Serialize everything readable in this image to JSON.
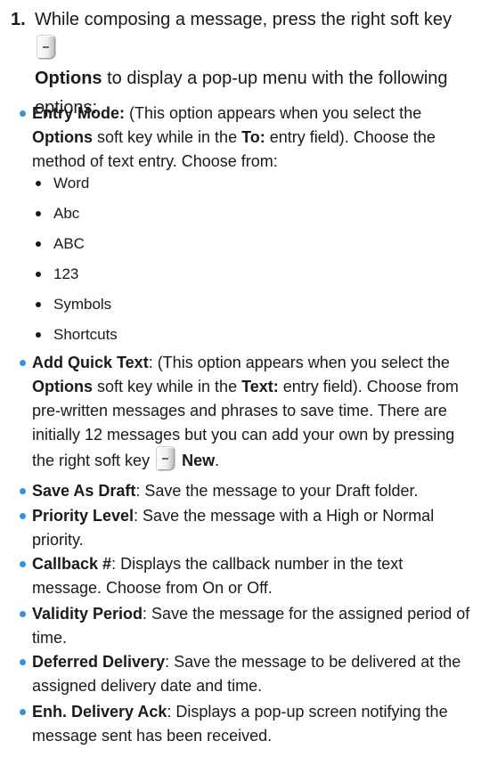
{
  "step": {
    "number": "1.",
    "text_1": "While composing a message, press the right soft key",
    "bold_1": "Options",
    "text_2": " to display a pop-up menu with the following options:"
  },
  "entry_mode": {
    "label": "Entry Mode:",
    "text_1": " (This option appears when you select the ",
    "bold_1": "Options",
    "text_2": " soft key while in the ",
    "bold_2": "To:",
    "text_3": " entry field). Choose the method of text entry. Choose from:",
    "options": [
      "Word",
      "Abc",
      "ABC",
      "123",
      "Symbols",
      "Shortcuts"
    ]
  },
  "add_quick_text": {
    "label": "Add Quick Text",
    "text_1": ": (This option appears when you select the ",
    "bold_1": "Options",
    "text_2": " soft key while in the ",
    "bold_2": "Text:",
    "text_3": " entry field). Choose from pre-written messages and phrases to save time. There are initially 12 messages but you can add your own by pressing the right soft key",
    "bold_3": "New",
    "text_4": "."
  },
  "items": [
    {
      "label": "Save As Draft",
      "text": ": Save the message to your Draft folder."
    },
    {
      "label": "Priority Level",
      "text": ": Save the message with a High or Normal priority."
    },
    {
      "label": "Callback #",
      "text": ": Displays the callback number in the text message. Choose from On or Off."
    },
    {
      "label": "Validity Period",
      "text": ": Save the message for the assigned period of time."
    },
    {
      "label": "Deferred Delivery",
      "text": ": Save the message to be delivered at the assigned delivery date and time."
    },
    {
      "label": "Enh. Delivery Ack",
      "text": ": Displays a pop-up screen notifying the message sent has been received."
    }
  ],
  "colors": {
    "bullet": "#3a8ed8",
    "text": "#1a1a1a"
  }
}
